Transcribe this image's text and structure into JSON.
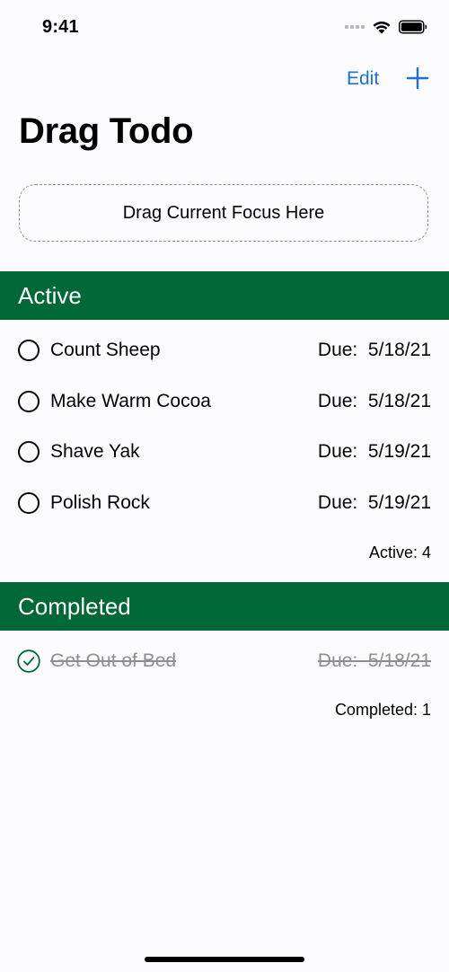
{
  "status_bar": {
    "time": "9:41"
  },
  "nav": {
    "edit_label": "Edit",
    "add_icon": "plus-icon"
  },
  "page": {
    "title": "Drag Todo"
  },
  "drop_zone": {
    "label": "Drag Current Focus Here"
  },
  "sections": {
    "active": {
      "title": "Active",
      "items": [
        {
          "title": "Count Sheep",
          "due": "Due:  5/18/21"
        },
        {
          "title": "Make Warm Cocoa",
          "due": "Due:  5/18/21"
        },
        {
          "title": "Shave Yak",
          "due": "Due:  5/19/21"
        },
        {
          "title": "Polish Rock",
          "due": "Due:  5/19/21"
        }
      ],
      "count_label": "Active: 4"
    },
    "completed": {
      "title": "Completed",
      "items": [
        {
          "title": "Get Out of Bed",
          "due": "Due:  5/18/21"
        }
      ],
      "count_label": "Completed: 1"
    }
  },
  "colors": {
    "accent": "#1a73d9",
    "section_header": "#006837",
    "background": "#fcfbfe",
    "completed_text": "#8e8e93"
  }
}
